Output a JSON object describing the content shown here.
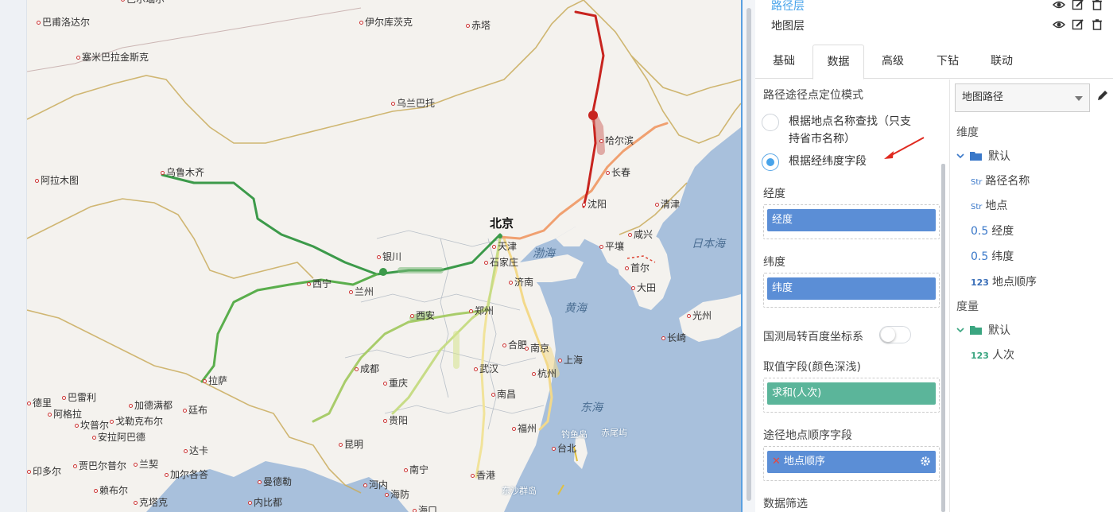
{
  "layers": [
    {
      "label": "路径层",
      "active": true
    },
    {
      "label": "地图层",
      "active": false
    }
  ],
  "tabs": [
    {
      "label": "基础",
      "active": false
    },
    {
      "label": "数据",
      "active": true
    },
    {
      "label": "高级",
      "active": false
    },
    {
      "label": "下钻",
      "active": false
    },
    {
      "label": "联动",
      "active": false
    }
  ],
  "data_panel": {
    "positioning_mode_title": "路径途径点定位模式",
    "radio_by_name_line1": "根据地点名称查找（只支",
    "radio_by_name_line2": "持省市名称）",
    "radio_by_coords": "根据经纬度字段",
    "selected_mode": "根据经纬度字段",
    "longitude_title": "经度",
    "longitude_field": "经度",
    "latitude_title": "纬度",
    "latitude_field": "纬度",
    "coord_convert_label": "国测局转百度坐标系",
    "coord_convert_on": false,
    "value_field_title": "取值字段(颜色深浅)",
    "value_field": "求和(人次)",
    "order_field_title": "途径地点顺序字段",
    "order_field": "地点顺序",
    "filter_title": "数据筛选"
  },
  "field_panel": {
    "dataset": "地图路径",
    "dimension_title": "维度",
    "dimension_folder": "默认",
    "dimensions": [
      {
        "type": "Str",
        "name": "路径名称"
      },
      {
        "type": "Str",
        "name": "地点"
      },
      {
        "type": "0.5",
        "name": "经度"
      },
      {
        "type": "0.5",
        "name": "纬度"
      },
      {
        "type": "123",
        "name": "地点顺序"
      }
    ],
    "measure_title": "度量",
    "measure_folder": "默认",
    "measures": [
      {
        "type": "123",
        "name": "人次"
      }
    ]
  },
  "map": {
    "capital": "北京",
    "cities": [
      {
        "name": "巴尔瑙尔"
      },
      {
        "name": "巴甫洛达尔"
      },
      {
        "name": "伊尔库茨克"
      },
      {
        "name": "赤塔"
      },
      {
        "name": "塞米巴拉金斯克"
      },
      {
        "name": "乌兰巴托"
      },
      {
        "name": "乌鲁木齐"
      },
      {
        "name": "阿拉木图"
      },
      {
        "name": "哈尔滨"
      },
      {
        "name": "长春"
      },
      {
        "name": "沈阳"
      },
      {
        "name": "清津"
      },
      {
        "name": "咸兴"
      },
      {
        "name": "平壤"
      },
      {
        "name": "首尔"
      },
      {
        "name": "大田"
      },
      {
        "name": "光州"
      },
      {
        "name": "长崎"
      },
      {
        "name": "天津"
      },
      {
        "name": "石家庄"
      },
      {
        "name": "济南"
      },
      {
        "name": "银川"
      },
      {
        "name": "兰州"
      },
      {
        "name": "西宁"
      },
      {
        "name": "西安"
      },
      {
        "name": "郑州"
      },
      {
        "name": "合肥"
      },
      {
        "name": "南京"
      },
      {
        "name": "上海"
      },
      {
        "name": "杭州"
      },
      {
        "name": "武汉"
      },
      {
        "name": "成都"
      },
      {
        "name": "重庆"
      },
      {
        "name": "贵阳"
      },
      {
        "name": "南昌"
      },
      {
        "name": "福州"
      },
      {
        "name": "台北"
      },
      {
        "name": "昆明"
      },
      {
        "name": "南宁"
      },
      {
        "name": "香港"
      },
      {
        "name": "海口"
      },
      {
        "name": "河内"
      },
      {
        "name": "海防"
      },
      {
        "name": "拉萨"
      },
      {
        "name": "巴雷利"
      },
      {
        "name": "加德满都"
      },
      {
        "name": "廷布"
      },
      {
        "name": "阿格拉"
      },
      {
        "name": "坎普尔"
      },
      {
        "name": "戈勒克布尔"
      },
      {
        "name": "安拉阿巴德"
      },
      {
        "name": "达卡"
      },
      {
        "name": "贾巴尔普尔"
      },
      {
        "name": "兰契"
      },
      {
        "name": "加尔各答"
      },
      {
        "name": "赖布尔"
      },
      {
        "name": "曼德勒"
      },
      {
        "name": "内比都"
      },
      {
        "name": "克塔克"
      },
      {
        "name": "德里"
      },
      {
        "name": "印多尔"
      }
    ],
    "seas": [
      {
        "name": "渤海"
      },
      {
        "name": "黄海"
      },
      {
        "name": "东海"
      },
      {
        "name": "日本海"
      }
    ],
    "islands": [
      {
        "name": "钓鱼岛"
      },
      {
        "name": "赤尾屿"
      },
      {
        "name": "东沙群岛"
      }
    ]
  },
  "colors": {
    "accent": "#47a3ea",
    "pill_blue": "#5b8ed6",
    "pill_green": "#5bb59a",
    "route_red": "#c8241f",
    "route_orange": "#f0a070",
    "route_green": "#3c9a4a",
    "route_yellow": "#f1e39a",
    "sea": "#a8c0dc",
    "land": "#f4f2ee"
  }
}
